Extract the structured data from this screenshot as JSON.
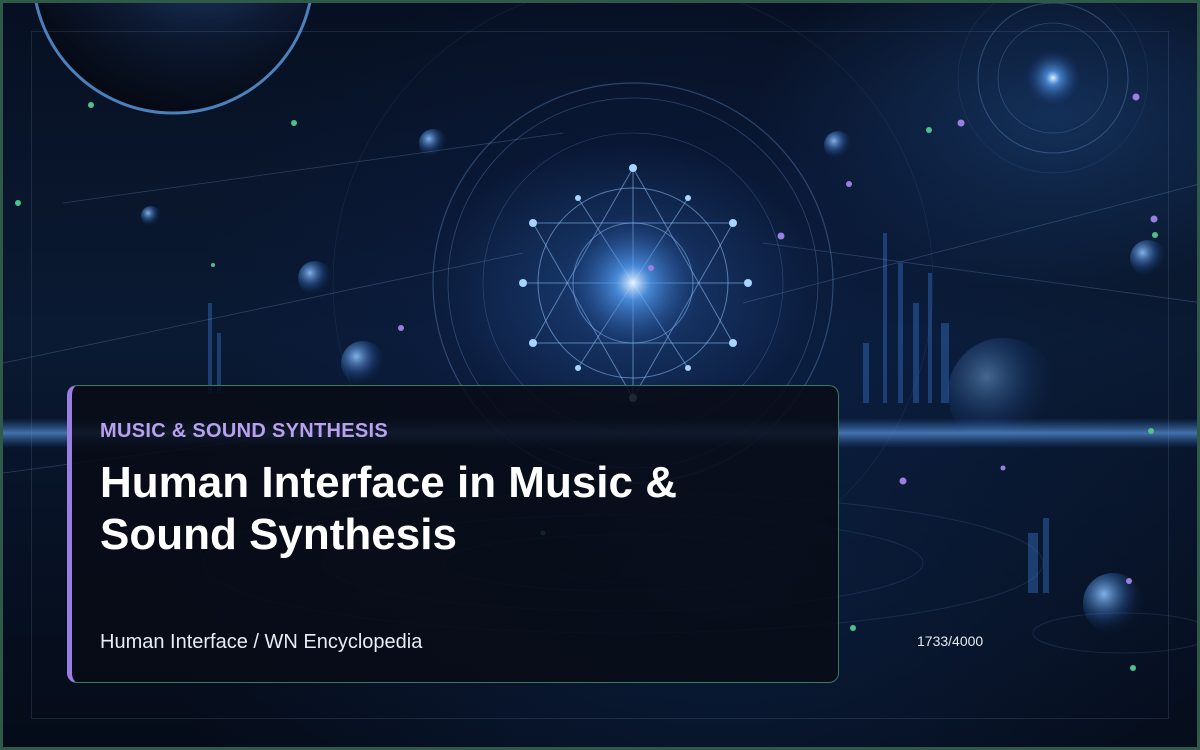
{
  "card": {
    "category": "MUSIC & SOUND SYNTHESIS",
    "title": "Human Interface in Music & Sound Synthesis",
    "byline": "Human Interface / WN Encyclopedia"
  },
  "counter": {
    "text": "1733/4000"
  },
  "colors": {
    "accent_purple": "#9b7fe0",
    "category_text": "#b7a1f0",
    "card_border": "#3d7a5f",
    "frame_border": "#2f5a4a",
    "background": "#071022"
  },
  "background": {
    "description_icons": [
      "planet-icon",
      "sacred-geometry-icon",
      "orbital-ring-icon",
      "city-skyline-icon"
    ]
  }
}
